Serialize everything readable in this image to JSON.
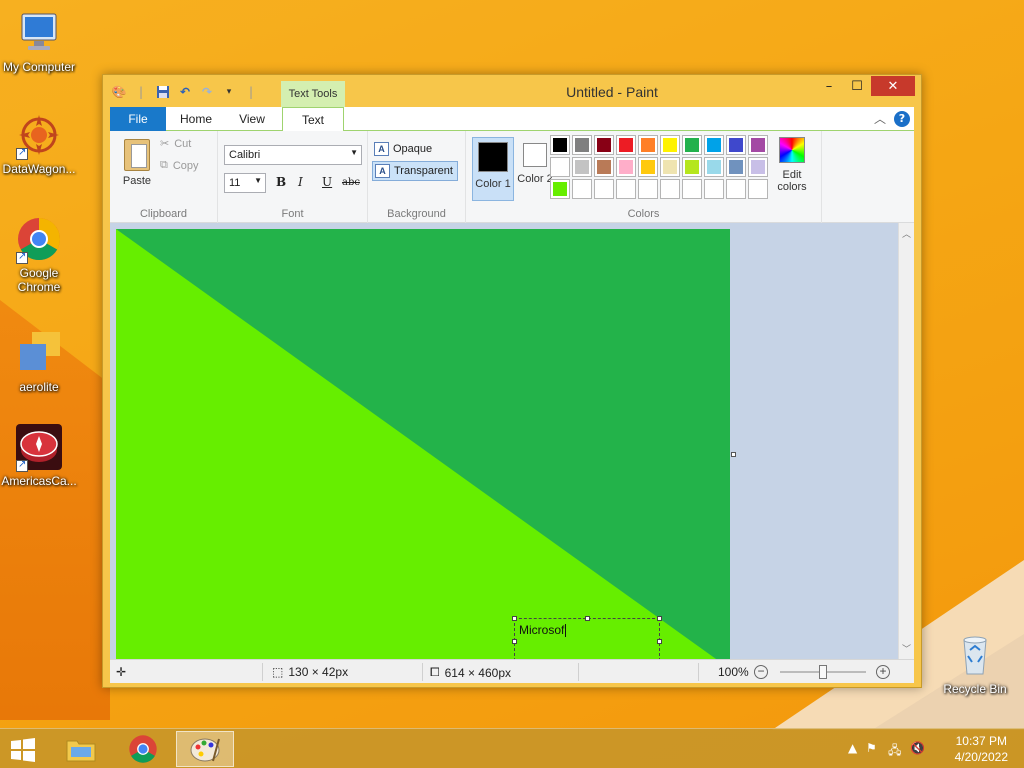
{
  "desktop": {
    "icons": [
      {
        "label": "My Computer"
      },
      {
        "label": "DataWagon..."
      },
      {
        "label": "Google Chrome"
      },
      {
        "label": "aerolite"
      },
      {
        "label": "AmericasCa..."
      },
      {
        "label": "Recycle Bin"
      }
    ]
  },
  "window": {
    "title": "Untitled - Paint",
    "contextual_tab": "Text Tools",
    "tabs": [
      "File",
      "Home",
      "View",
      "Text"
    ],
    "active_tab": "Text"
  },
  "ribbon": {
    "clipboard": {
      "label": "Clipboard",
      "paste": "Paste",
      "cut": "Cut",
      "copy": "Copy"
    },
    "font": {
      "label": "Font",
      "family": "Calibri",
      "size": "11",
      "bold": "B",
      "italic": "I",
      "underline": "U",
      "strike": "abc"
    },
    "background": {
      "label": "Background",
      "opaque": "Opaque",
      "transparent": "Transparent",
      "selected": "Transparent"
    },
    "colors": {
      "label": "Colors",
      "color1_label": "Color 1",
      "color2_label": "Color 2",
      "color1": "#000000",
      "color2": "#ffffff",
      "edit": "Edit colors",
      "palette": [
        "#000000",
        "#7f7f7f",
        "#880015",
        "#ed1c24",
        "#ff7f27",
        "#fff200",
        "#22b14c",
        "#00a2e8",
        "#3f48cc",
        "#a349a4",
        "#ffffff",
        "#c3c3c3",
        "#b97a57",
        "#ffaec9",
        "#ffc90e",
        "#efe4b0",
        "#b5e61d",
        "#99d9ea",
        "#7092be",
        "#c8bfe7",
        "#66ee00",
        "#ffffff",
        "#ffffff",
        "#ffffff",
        "#ffffff",
        "#ffffff",
        "#ffffff",
        "#ffffff",
        "#ffffff",
        "#ffffff"
      ]
    }
  },
  "canvas": {
    "colors": {
      "dark": "#23b34a",
      "light": "#66ee00"
    },
    "text_content": "Microsof"
  },
  "status": {
    "selection_size": "130 × 42px",
    "image_size": "614 × 460px",
    "zoom": "100%",
    "zoom_level": 0.5
  },
  "taskbar": {
    "time": "10:37 PM",
    "date": "4/20/2022"
  }
}
